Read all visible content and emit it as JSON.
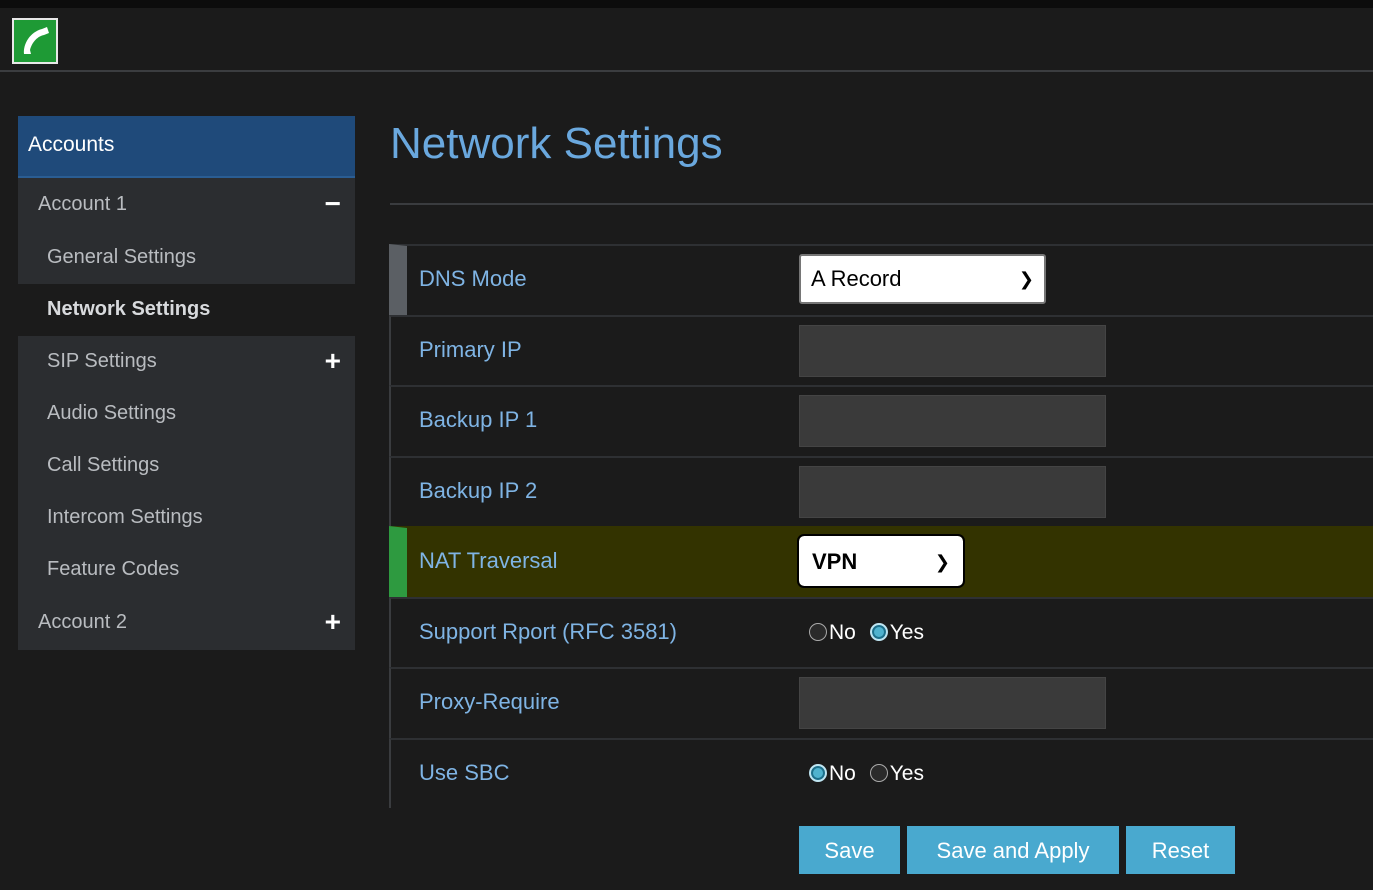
{
  "app": {
    "logo_icon": "phone-icon",
    "brand_color": "#1e9a35"
  },
  "sidebar": {
    "header": "Accounts",
    "accounts": [
      {
        "label": "Account 1",
        "toggle": "−",
        "expanded": true,
        "items": [
          {
            "label": "General Settings"
          },
          {
            "label": "Network Settings",
            "active": true
          },
          {
            "label": "SIP Settings",
            "toggle": "+"
          },
          {
            "label": "Audio Settings"
          },
          {
            "label": "Call Settings"
          },
          {
            "label": "Intercom Settings"
          },
          {
            "label": "Feature Codes"
          }
        ]
      },
      {
        "label": "Account 2",
        "toggle": "+",
        "expanded": false
      }
    ]
  },
  "page": {
    "title": "Network Settings"
  },
  "form": {
    "dns_mode": {
      "label": "DNS Mode",
      "value": "A Record"
    },
    "primary_ip": {
      "label": "Primary IP",
      "value": ""
    },
    "backup_ip_1": {
      "label": "Backup IP 1",
      "value": ""
    },
    "backup_ip_2": {
      "label": "Backup IP 2",
      "value": ""
    },
    "nat_traversal": {
      "label": "NAT Traversal",
      "value": "VPN"
    },
    "support_rport": {
      "label": "Support Rport (RFC 3581)",
      "options": [
        "No",
        "Yes"
      ],
      "selected": "Yes"
    },
    "proxy_require": {
      "label": "Proxy-Require",
      "value": ""
    },
    "use_sbc": {
      "label": "Use SBC",
      "options": [
        "No",
        "Yes"
      ],
      "selected": "No"
    }
  },
  "buttons": {
    "save": "Save",
    "save_apply": "Save and Apply",
    "reset": "Reset"
  },
  "colors": {
    "title": "#6aa8de",
    "label": "#7fb4e4",
    "button": "#49a9cf",
    "highlight_row": "#333300",
    "highlight_marker": "#2e9a40",
    "sidebar_header": "#1f4a7a"
  }
}
